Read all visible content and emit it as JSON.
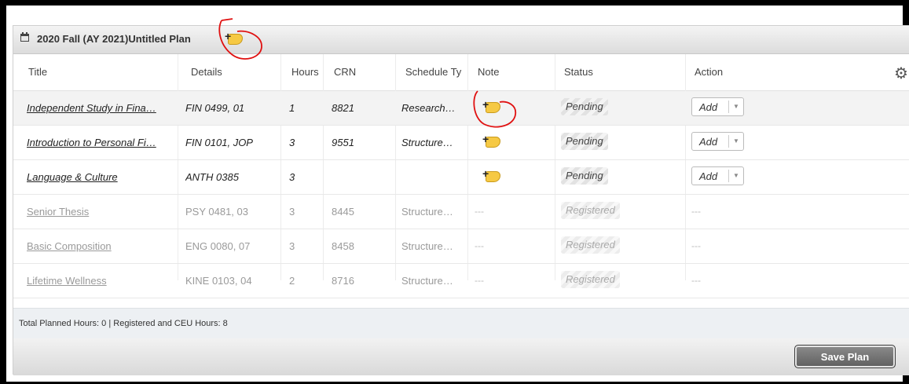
{
  "plan": {
    "title": "2020 Fall (AY 2021)Untitled Plan"
  },
  "columns": {
    "title": "Title",
    "details": "Details",
    "hours": "Hours",
    "crn": "CRN",
    "schedule": "Schedule Ty",
    "note": "Note",
    "status": "Status",
    "action": "Action"
  },
  "rows": [
    {
      "title": "Independent Study in Fina…",
      "details": "FIN 0499, 01",
      "hours": "1",
      "crn": "8821",
      "schedule": "Research…",
      "status": "Pending",
      "action": "Add"
    },
    {
      "title": "Introduction to Personal Fi…",
      "details": "FIN 0101, JOP",
      "hours": "3",
      "crn": "9551",
      "schedule": "Structure…",
      "status": "Pending",
      "action": "Add"
    },
    {
      "title": "Language & Culture",
      "details": "ANTH 0385",
      "hours": "3",
      "crn": "",
      "schedule": "",
      "status": "Pending",
      "action": "Add"
    },
    {
      "title": "Senior Thesis",
      "details": "PSY 0481, 03",
      "hours": "3",
      "crn": "8445",
      "schedule": "Structure…",
      "note": "---",
      "status": "Registered",
      "action": "---"
    },
    {
      "title": "Basic Composition",
      "details": "ENG 0080, 07",
      "hours": "3",
      "crn": "8458",
      "schedule": "Structure…",
      "note": "---",
      "status": "Registered",
      "action": "---"
    },
    {
      "title": "Lifetime Wellness",
      "details": "KINE 0103, 04",
      "hours": "2",
      "crn": "8716",
      "schedule": "Structure…",
      "note": "---",
      "status": "Registered",
      "action": "---"
    }
  ],
  "footer": {
    "totals": "Total Planned Hours: 0 | Registered and CEU Hours: 8",
    "save_label": "Save Plan"
  },
  "colors": {
    "note_icon": "#f6c944",
    "annotation": "#e01010",
    "save_button": "#6f6f6f"
  },
  "icons": {
    "header": "calendar-icon",
    "settings": "gear-icon",
    "note": "add-note-icon"
  }
}
